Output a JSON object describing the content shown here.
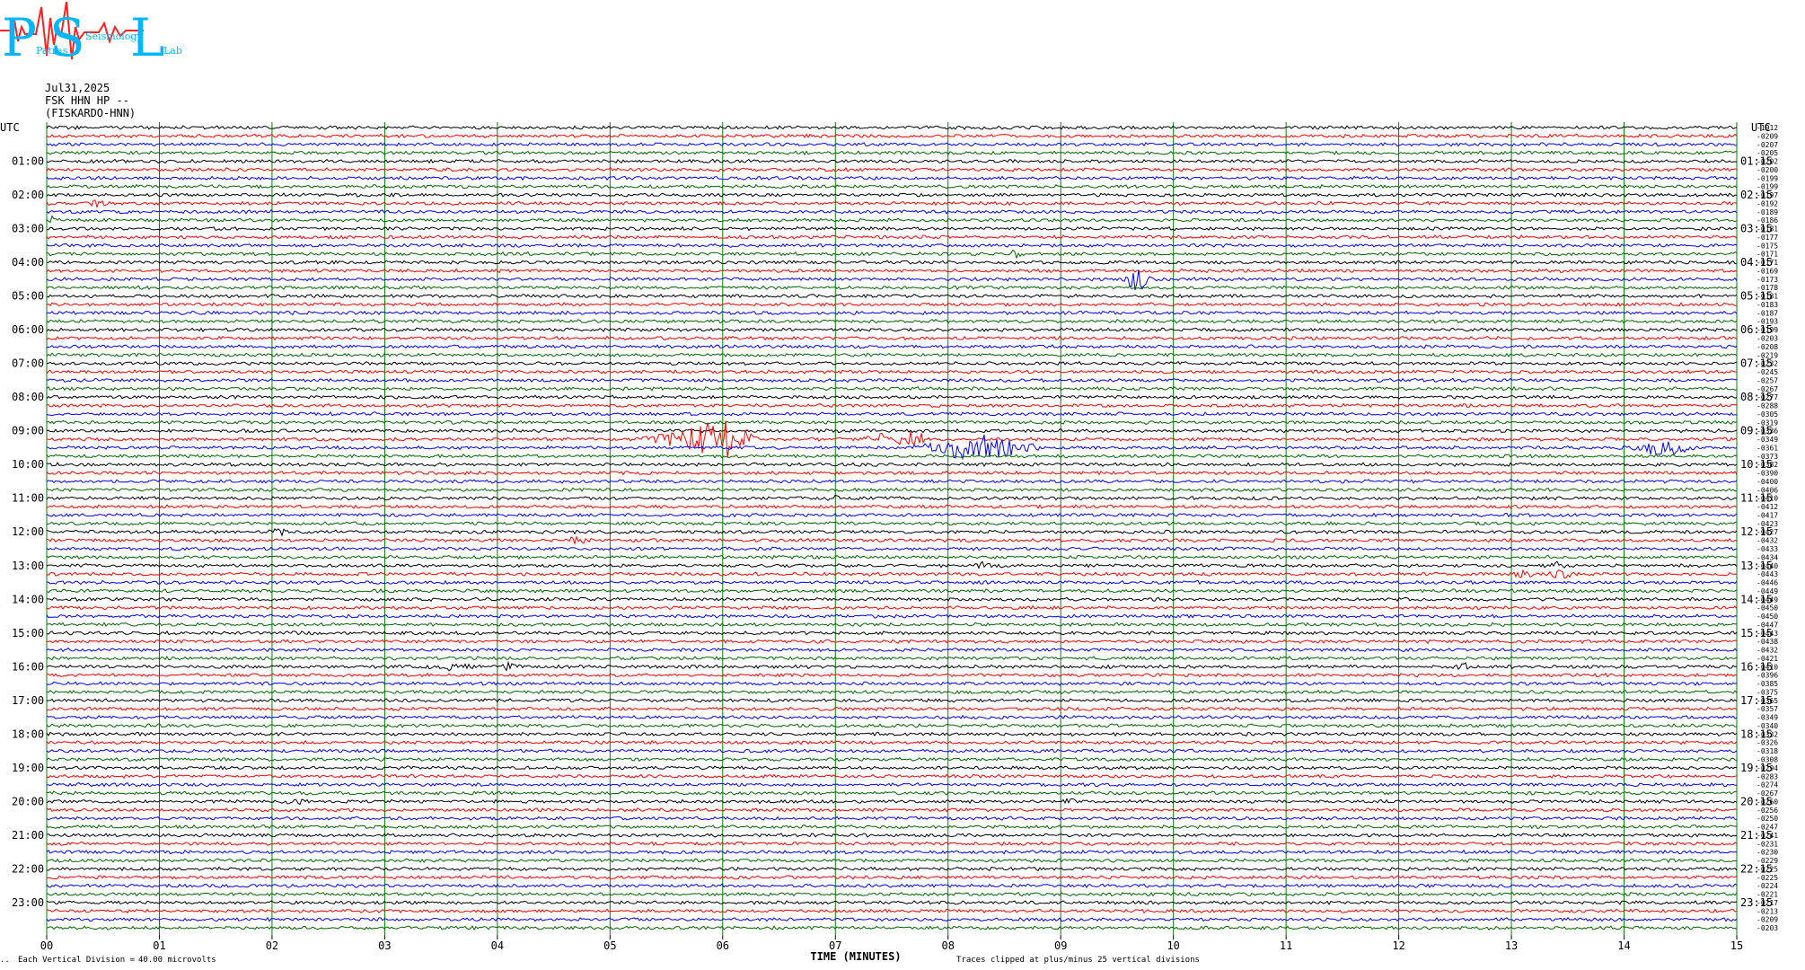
{
  "header": {
    "logo_letters": "PSL",
    "logo_words": [
      "Patras",
      "Seismology",
      "Lab"
    ],
    "date": "Jul31,2025",
    "station_line": "FSK HHN HP --",
    "station_name": "(FISKARDO-HNN)"
  },
  "colors": {
    "row_cycle": [
      "#000000",
      "#ff0000",
      "#0000ff",
      "#006600"
    ],
    "grid": "#008000",
    "logo": "#00b7ff",
    "logo_trace": "#ff2020"
  },
  "chart_data": {
    "type": "helicorder",
    "title": "",
    "xlabel": "TIME (MINUTES)",
    "x_ticks": [
      "00",
      "01",
      "02",
      "03",
      "04",
      "05",
      "06",
      "07",
      "08",
      "09",
      "10",
      "11",
      "12",
      "13",
      "14",
      "15"
    ],
    "xlim": [
      0,
      15
    ],
    "rows_count": 96,
    "row_minutes": 15,
    "left_axis_title": "UTC",
    "right_axis_title": "UTC",
    "left_labels": [
      "01:00",
      "02:00",
      "03:00",
      "04:00",
      "05:00",
      "06:00",
      "07:00",
      "08:00",
      "09:00",
      "10:00",
      "11:00",
      "12:00",
      "13:00",
      "14:00",
      "15:00",
      "16:00",
      "17:00",
      "18:00",
      "19:00",
      "20:00",
      "21:00",
      "22:00",
      "23:00"
    ],
    "right_labels": [
      "01:15",
      "02:15",
      "03:15",
      "04:15",
      "05:15",
      "06:15",
      "07:15",
      "08:15",
      "09:15",
      "10:15",
      "11:15",
      "12:15",
      "13:15",
      "14:15",
      "15:15",
      "16:15",
      "17:15",
      "18:15",
      "19:15",
      "20:15",
      "21:15",
      "22:15",
      "23:15"
    ],
    "row_offsets": [
      "-1912",
      "-0209",
      "-0207",
      "-0205",
      "-0202",
      "-0200",
      "-0199",
      "-0199",
      "-0197",
      "-0192",
      "-0189",
      "-0186",
      "-0181",
      "-0177",
      "-0175",
      "-0171",
      "-0171",
      "-0169",
      "-0173",
      "-0178",
      "-0181",
      "-0183",
      "-0187",
      "-0193",
      "-0199",
      "-0203",
      "-0208",
      "-0219",
      "-0232",
      "-0245",
      "-0257",
      "-0267",
      "-0277",
      "-0288",
      "-0305",
      "-0319",
      "-0336",
      "-0349",
      "-0361",
      "-0373",
      "-0382",
      "-0390",
      "-0400",
      "-0406",
      "-0410",
      "-0412",
      "-0417",
      "-0423",
      "-0427",
      "-0432",
      "-0433",
      "-0434",
      "-0440",
      "-0443",
      "-0446",
      "-0449",
      "-0449",
      "-0450",
      "-0450",
      "-0447",
      "-0443",
      "-0438",
      "-0432",
      "-0421",
      "-0410",
      "-0396",
      "-0385",
      "-0375",
      "-0365",
      "-0357",
      "-0349",
      "-0340",
      "-0332",
      "-0326",
      "-0318",
      "-0308",
      "-0294",
      "-0283",
      "-0274",
      "-0267",
      "-0260",
      "-0256",
      "-0250",
      "-0247",
      "-0241",
      "-0231",
      "-0230",
      "-0229",
      "-0225",
      "-0225",
      "-0224",
      "-0221",
      "-0217",
      "-0213",
      "-0209",
      "-0203"
    ],
    "events": [
      {
        "row": 9,
        "minute": 0.45,
        "amp": 3,
        "dur": 0.12
      },
      {
        "row": 11,
        "minute": 0.05,
        "amp": 3,
        "dur": 0.05
      },
      {
        "row": 15,
        "minute": 8.6,
        "amp": 6,
        "dur": 0.05
      },
      {
        "row": 18,
        "minute": 9.68,
        "amp": 16,
        "dur": 0.12
      },
      {
        "row": 37,
        "minute": 5.6,
        "amp": 8,
        "dur": 0.35
      },
      {
        "row": 37,
        "minute": 5.98,
        "amp": 24,
        "dur": 0.35
      },
      {
        "row": 37,
        "minute": 7.4,
        "amp": 5,
        "dur": 0.2
      },
      {
        "row": 37,
        "minute": 7.68,
        "amp": 14,
        "dur": 0.15
      },
      {
        "row": 38,
        "minute": 8.25,
        "amp": 15,
        "dur": 0.6
      },
      {
        "row": 38,
        "minute": 14.35,
        "amp": 10,
        "dur": 0.3
      },
      {
        "row": 44,
        "minute": 7.0,
        "amp": 3,
        "dur": 0.1
      },
      {
        "row": 48,
        "minute": 2.05,
        "amp": 4,
        "dur": 0.1
      },
      {
        "row": 49,
        "minute": 4.7,
        "amp": 4,
        "dur": 0.1
      },
      {
        "row": 52,
        "minute": 8.3,
        "amp": 3,
        "dur": 0.1
      },
      {
        "row": 52,
        "minute": 13.4,
        "amp": 3,
        "dur": 0.15
      },
      {
        "row": 53,
        "minute": 13.1,
        "amp": 4,
        "dur": 0.1
      },
      {
        "row": 53,
        "minute": 13.45,
        "amp": 4,
        "dur": 0.15
      },
      {
        "row": 64,
        "minute": 3.6,
        "amp": 3,
        "dur": 0.25
      },
      {
        "row": 64,
        "minute": 4.1,
        "amp": 5,
        "dur": 0.1
      },
      {
        "row": 64,
        "minute": 12.55,
        "amp": 5,
        "dur": 0.1
      },
      {
        "row": 80,
        "minute": 2.2,
        "amp": 3,
        "dur": 0.1
      },
      {
        "row": 80,
        "minute": 9.1,
        "amp": 2,
        "dur": 0.1
      }
    ]
  },
  "footer": {
    "vertical_division_label": "Each Vertical Division =",
    "vertical_division_value": "40.00 microvolts",
    "clip_note": "Traces clipped at plus/minus 25 vertical divisions"
  }
}
